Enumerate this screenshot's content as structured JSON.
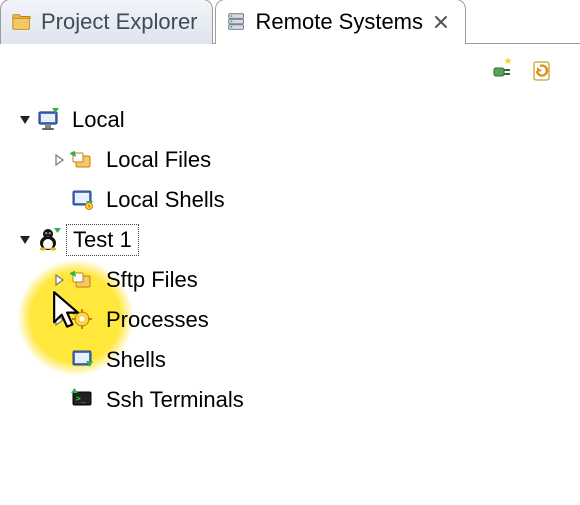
{
  "tabs": {
    "project_explorer": {
      "label": "Project Explorer"
    },
    "remote_systems": {
      "label": "Remote Systems"
    }
  },
  "toolbar": {
    "new_connection": "New Connection",
    "refresh": "Refresh"
  },
  "tree": {
    "local": {
      "label": "Local"
    },
    "local_files": {
      "label": "Local Files"
    },
    "local_shells": {
      "label": "Local Shells"
    },
    "test1": {
      "label": "Test 1"
    },
    "sftp_files": {
      "label": "Sftp Files"
    },
    "processes": {
      "label": "Processes"
    },
    "shells": {
      "label": "Shells"
    },
    "ssh_terminals": {
      "label": "Ssh Terminals"
    }
  }
}
